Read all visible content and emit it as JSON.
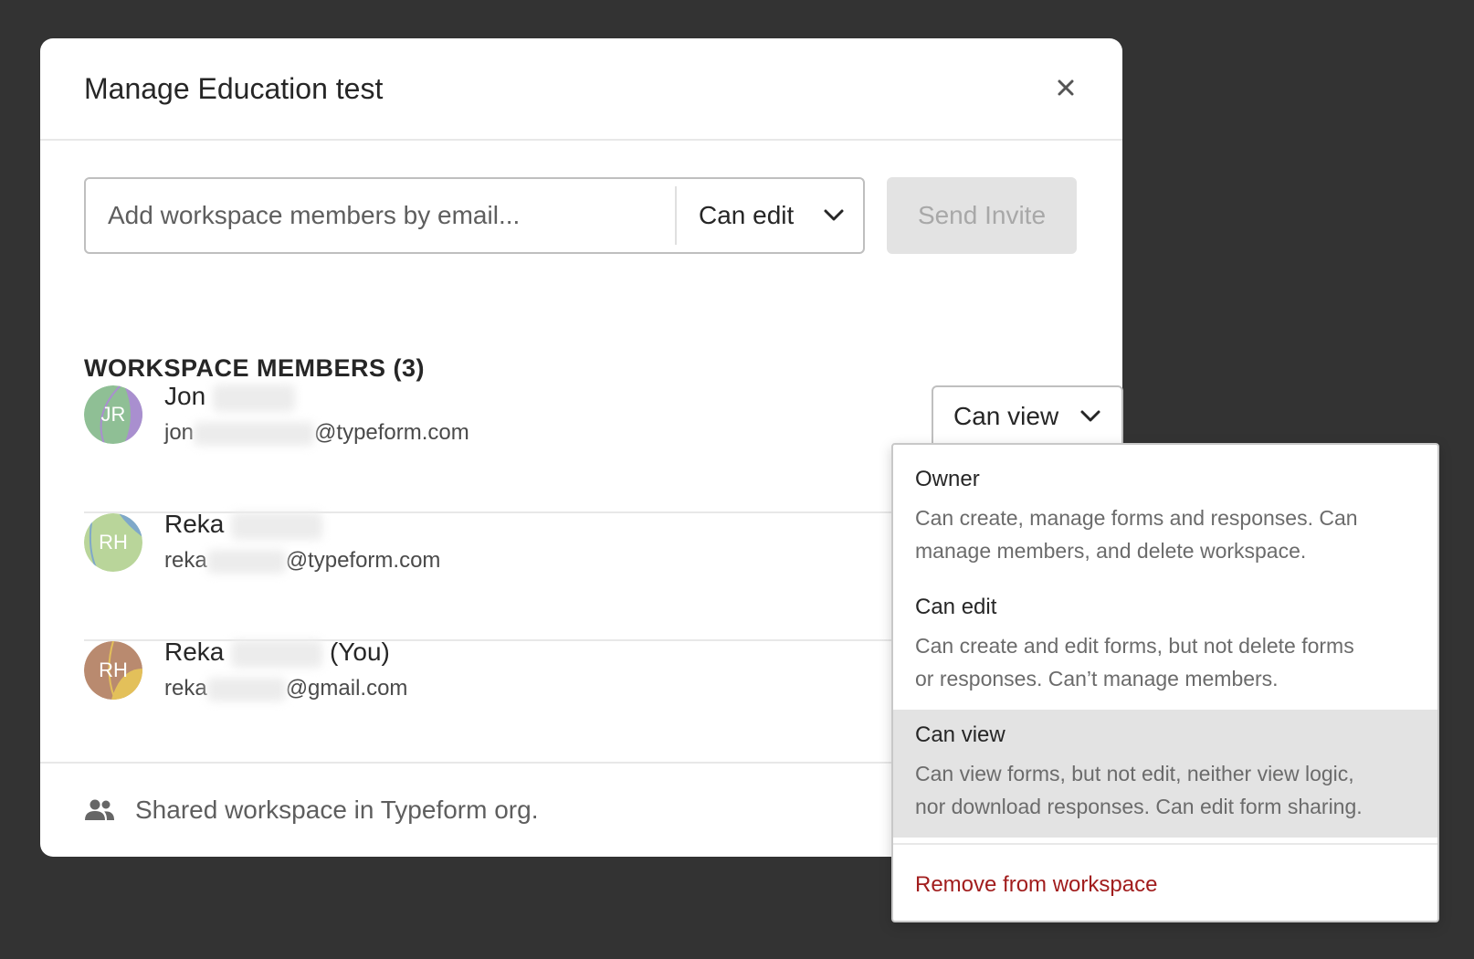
{
  "modal": {
    "title": "Manage Education test"
  },
  "invite": {
    "email_placeholder": "Add workspace members by email...",
    "role_value": "Can edit",
    "send_label": "Send Invite"
  },
  "members_section": {
    "heading": "WORKSPACE MEMBERS (3)",
    "members": [
      {
        "initials": "JR",
        "first_name": "Jon",
        "suffix": "",
        "email_prefix": "jon",
        "email_domain": "@typeform.com",
        "role": "Can view"
      },
      {
        "initials": "RH",
        "first_name": "Reka",
        "suffix": "",
        "email_prefix": "reka",
        "email_domain": "@typeform.com"
      },
      {
        "initials": "RH",
        "first_name": "Reka",
        "suffix": "(You)",
        "email_prefix": "reka",
        "email_domain": "@gmail.com"
      }
    ]
  },
  "footer": {
    "icon": "people-icon",
    "text": "Shared workspace in Typeform org."
  },
  "role_dropdown": {
    "options": [
      {
        "title": "Owner",
        "desc_line1": "Can create, manage forms and responses. Can",
        "desc_line2": "manage members, and delete workspace."
      },
      {
        "title": "Can edit",
        "desc_line1": "Can create and edit forms, but not delete forms",
        "desc_line2": "or responses. Can’t manage members."
      },
      {
        "title": "Can view",
        "desc_line1": "Can view forms, but not edit, neither view logic,",
        "desc_line2": "nor download responses. Can edit form sharing."
      }
    ],
    "selected": "Can view",
    "remove_label": "Remove from workspace"
  },
  "colors": {
    "backdrop": "#333333",
    "remove_red": "#a11d1d",
    "avatar_jr": "#8fbf95",
    "avatar_rh1": "#b9d59a",
    "avatar_rh2": "#b98a6f"
  }
}
